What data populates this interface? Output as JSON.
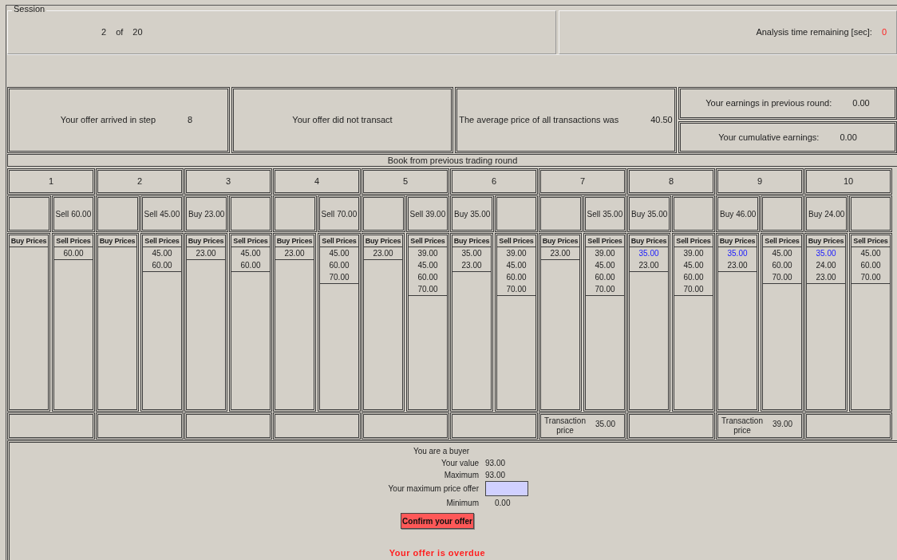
{
  "session": {
    "legend": "Session",
    "round": "2",
    "of_label": "of",
    "total": "20"
  },
  "analysis": {
    "label": "Analysis time remaining [sec]:",
    "value": "0"
  },
  "info": {
    "arrived": {
      "label": "Your offer arrived in step",
      "value": "8"
    },
    "transact": {
      "text": "Your offer did not transact"
    },
    "average": {
      "label": "The average price of all transactions was",
      "value": "40.50"
    },
    "earnings_previous": {
      "label": "Your earnings in previous round:",
      "value": "0.00"
    },
    "cumulative": {
      "label": "Your cumulative earnings:",
      "value": "0.00"
    }
  },
  "book": {
    "title": "Book from previous trading round",
    "columns": [
      {
        "number": "1",
        "offer": {
          "kind": "sell",
          "label": "Sell",
          "price": "60.00"
        },
        "buy_header": "Buy Prices",
        "sell_header": "Sell Prices",
        "sell": [
          "60.00"
        ]
      },
      {
        "number": "2",
        "offer": {
          "kind": "sell",
          "label": "Sell",
          "price": "45.00"
        },
        "buy_header": "Buy Prices",
        "sell_header": "Sell Prices",
        "sell": [
          "45.00",
          "60.00"
        ]
      },
      {
        "number": "3",
        "offer": {
          "kind": "buy",
          "label": "Buy",
          "price": "23.00"
        },
        "buy_header": "Buy Prices",
        "sell_header": "Sell Prices",
        "buy": [
          {
            "price": "23.00",
            "highlighted": false
          }
        ],
        "sell": [
          "45.00",
          "60.00"
        ]
      },
      {
        "number": "4",
        "offer": {
          "kind": "sell",
          "label": "Sell",
          "price": "70.00"
        },
        "buy_header": "Buy Prices",
        "sell_header": "Sell Prices",
        "buy": [
          {
            "price": "23.00",
            "highlighted": false
          }
        ],
        "sell": [
          "45.00",
          "60.00",
          "70.00"
        ]
      },
      {
        "number": "5",
        "offer": {
          "kind": "sell",
          "label": "Sell",
          "price": "39.00"
        },
        "buy_header": "Buy Prices",
        "sell_header": "Sell Prices",
        "buy": [
          {
            "price": "23.00",
            "highlighted": false
          }
        ],
        "sell": [
          "39.00",
          "45.00",
          "60.00",
          "70.00"
        ]
      },
      {
        "number": "6",
        "offer": {
          "kind": "buy",
          "label": "Buy",
          "price": "35.00"
        },
        "buy_header": "Buy Prices",
        "sell_header": "Sell Prices",
        "buy": [
          {
            "price": "35.00",
            "highlighted": false
          },
          {
            "price": "23.00",
            "highlighted": false
          }
        ],
        "sell": [
          "39.00",
          "45.00",
          "60.00",
          "70.00"
        ]
      },
      {
        "number": "7",
        "offer": {
          "kind": "sell",
          "label": "Sell",
          "price": "35.00"
        },
        "buy_header": "Buy Prices",
        "sell_header": "Sell Prices",
        "buy": [
          {
            "price": "23.00",
            "highlighted": false
          }
        ],
        "sell": [
          "39.00",
          "45.00",
          "60.00",
          "70.00"
        ],
        "transaction": {
          "label": "Transaction price",
          "price": "35.00"
        }
      },
      {
        "number": "8",
        "offer": {
          "kind": "buy",
          "label": "Buy",
          "price": "35.00"
        },
        "buy_header": "Buy Prices",
        "sell_header": "Sell Prices",
        "buy": [
          {
            "price": "35.00",
            "highlighted": true
          },
          {
            "price": "23.00",
            "highlighted": false
          }
        ],
        "sell": [
          "39.00",
          "45.00",
          "60.00",
          "70.00"
        ]
      },
      {
        "number": "9",
        "offer": {
          "kind": "buy",
          "label": "Buy",
          "price": "46.00"
        },
        "buy_header": "Buy Prices",
        "sell_header": "Sell Prices",
        "buy": [
          {
            "price": "35.00",
            "highlighted": true
          },
          {
            "price": "23.00",
            "highlighted": false
          }
        ],
        "sell": [
          "45.00",
          "60.00",
          "70.00"
        ],
        "transaction": {
          "label": "Transaction price",
          "price": "39.00"
        }
      },
      {
        "number": "10",
        "offer": {
          "kind": "buy",
          "label": "Buy",
          "price": "24.00"
        },
        "buy_header": "Buy Prices",
        "sell_header": "Sell Prices",
        "buy": [
          {
            "price": "35.00",
            "highlighted": true
          },
          {
            "price": "24.00",
            "highlighted": false
          },
          {
            "price": "23.00",
            "highlighted": false
          }
        ],
        "sell": [
          "45.00",
          "60.00",
          "70.00"
        ]
      }
    ]
  },
  "entry": {
    "role": "You are a buyer",
    "your_value": {
      "label": "Your value",
      "value": "93.00"
    },
    "maximum": {
      "label": "Maximum",
      "value": "93.00"
    },
    "offer_field": {
      "label": "Your maximum price offer"
    },
    "minimum": {
      "label": "Minimum",
      "value": "0.00"
    },
    "confirm_button": "Confirm your offer",
    "message": "Your offer is overdue"
  }
}
